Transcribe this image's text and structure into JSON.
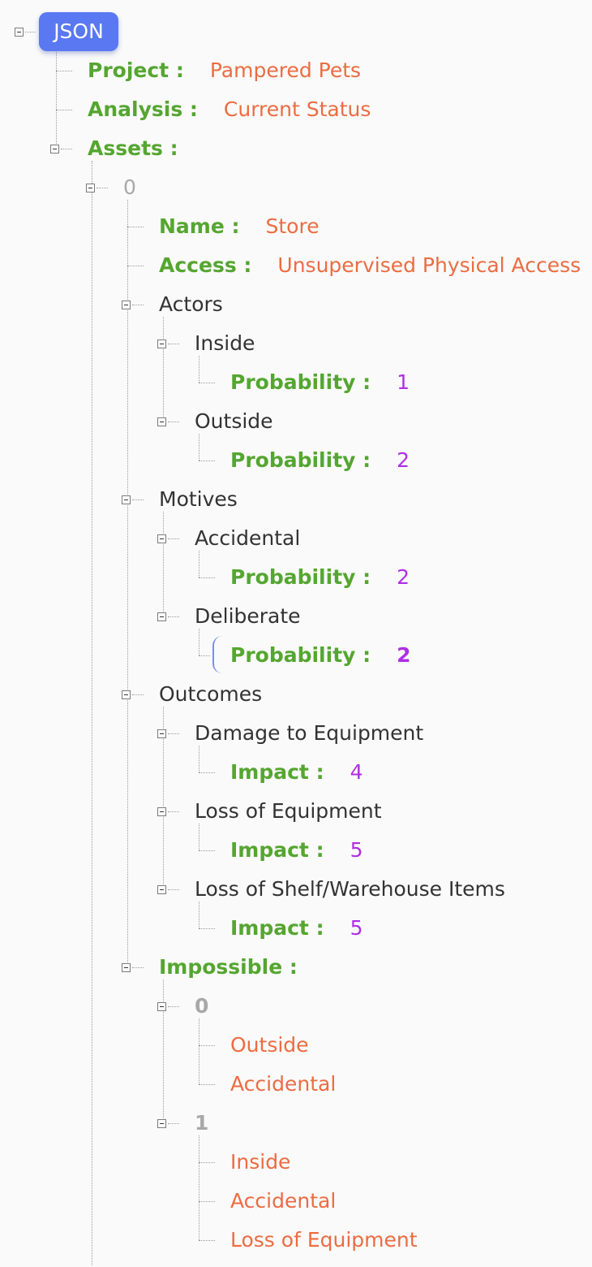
{
  "root_label": "JSON",
  "project": {
    "key": "Project :",
    "value": "Pampered Pets"
  },
  "analysis": {
    "key": "Analysis :",
    "value": "Current Status"
  },
  "assets": {
    "key": "Assets :",
    "item0": {
      "index": "0",
      "name": {
        "key": "Name :",
        "value": "Store"
      },
      "access": {
        "key": "Access :",
        "value": "Unsupervised Physical Access"
      },
      "actors": {
        "label": "Actors",
        "inside": {
          "label": "Inside",
          "key": "Probability :",
          "value": "1"
        },
        "outside": {
          "label": "Outside",
          "key": "Probability :",
          "value": "2"
        }
      },
      "motives": {
        "label": "Motives",
        "accidental": {
          "label": "Accidental",
          "key": "Probability :",
          "value": "2"
        },
        "deliberate": {
          "label": "Deliberate",
          "key": "Probability :",
          "value": "2"
        }
      },
      "outcomes": {
        "label": "Outcomes",
        "damage": {
          "label": "Damage to Equipment",
          "key": "Impact :",
          "value": "4"
        },
        "loss_equipment": {
          "label": "Loss of Equipment",
          "key": "Impact :",
          "value": "5"
        },
        "loss_items": {
          "label": "Loss of Shelf/Warehouse Items",
          "key": "Impact :",
          "value": "5"
        }
      },
      "impossible": {
        "key": "Impossible :",
        "set0": {
          "index": "0",
          "values": [
            "Outside",
            "Accidental"
          ]
        },
        "set1": {
          "index": "1",
          "values": [
            "Inside",
            "Accidental",
            "Loss of Equipment"
          ]
        }
      }
    }
  },
  "colors": {
    "key": "#55a630",
    "string": "#ec6c42",
    "number": "#b02ee6",
    "root_badge": "#5978f2",
    "index": "#a8a8a8"
  }
}
